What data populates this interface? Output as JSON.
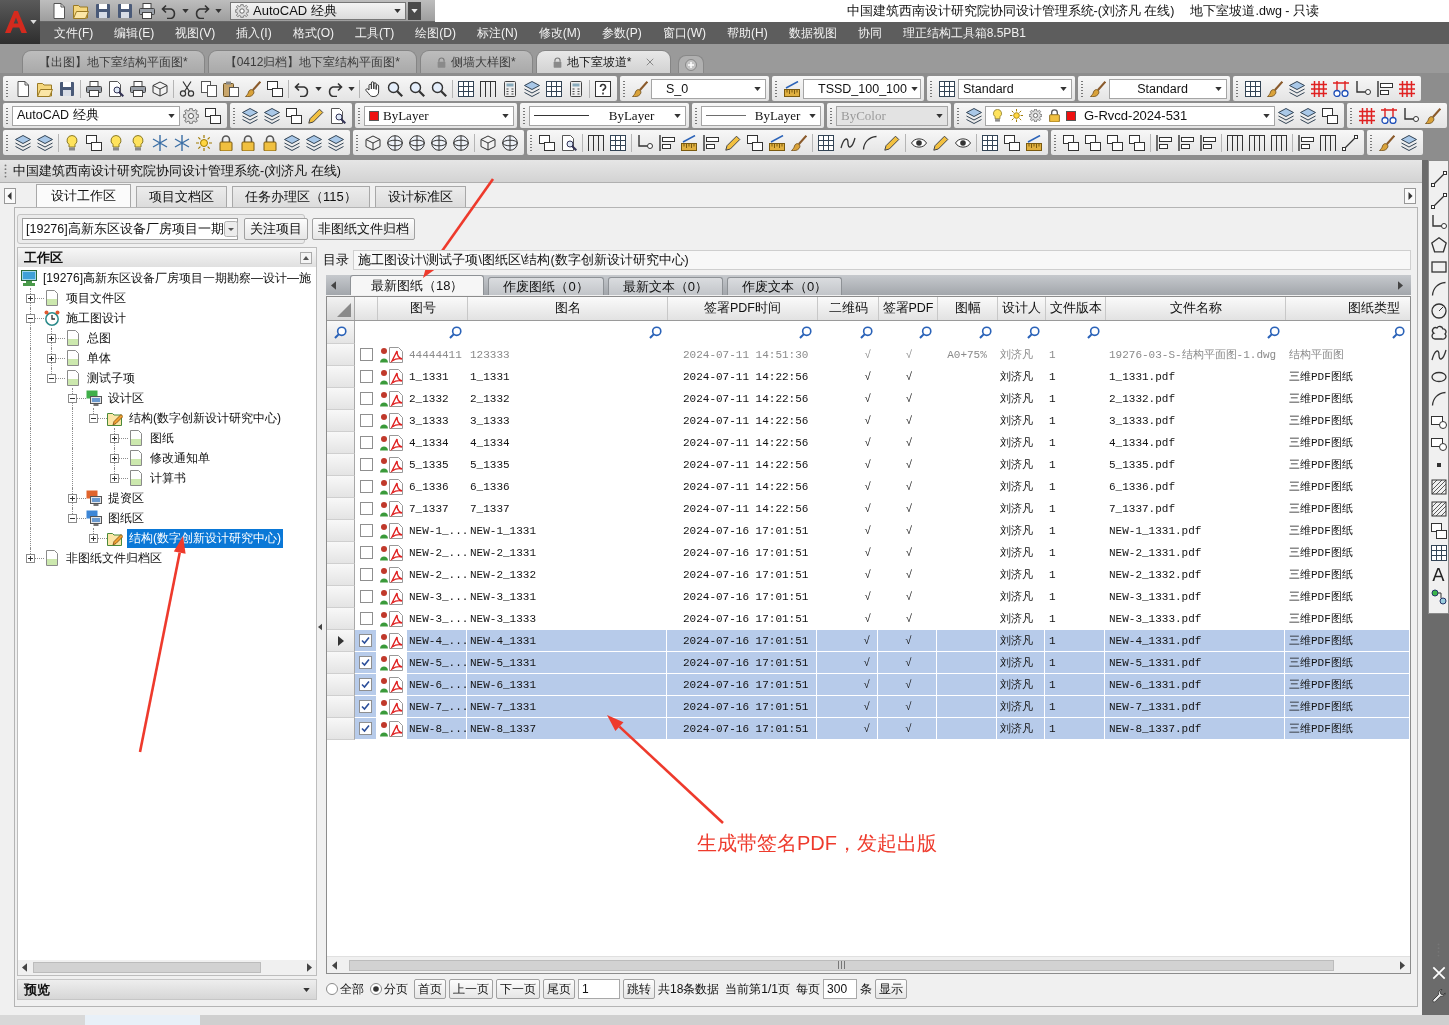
{
  "app": {
    "workspace": "AutoCAD 经典"
  },
  "title": {
    "app_title": "中国建筑西南设计研究院协同设计管理系统-(刘济凡 在线)",
    "document": "地下室坡道.dwg - 只读"
  },
  "menu": [
    "文件(F)",
    "编辑(E)",
    "视图(V)",
    "插入(I)",
    "格式(O)",
    "工具(T)",
    "绘图(D)",
    "标注(N)",
    "修改(M)",
    "参数(P)",
    "窗口(W)",
    "帮助(H)",
    "数据视图",
    "协同",
    "理正结构工具箱8.5PB1"
  ],
  "doc_tabs": [
    {
      "label": "【出图】地下室结构平面图*",
      "locked": false,
      "selected": false
    },
    {
      "label": "【0412归档】地下室结构平面图*",
      "locked": false,
      "selected": false
    },
    {
      "label": "侧墙大样图*",
      "locked": true,
      "selected": false
    },
    {
      "label": "地下室坡道*",
      "locked": true,
      "selected": true
    }
  ],
  "toolbars": {
    "text_style": "S_0",
    "dim_style": "TSSD_100_100",
    "table_style": "Standard",
    "multileader_style": "Standard",
    "workspace": "AutoCAD 经典",
    "color_mode": "ByLayer",
    "linetype": "ByLayer",
    "lineweight": "ByLayer",
    "plot_style": {
      "value": "ByColor",
      "disabled": true
    },
    "layer": "G-Rvcd-2024-531"
  },
  "panel": {
    "title": "中国建筑西南设计研究院协同设计管理系统-(刘济凡 在线)",
    "tabs": [
      {
        "label": "设计工作区",
        "selected": true
      },
      {
        "label": "项目文档区",
        "selected": false
      },
      {
        "label": "任务办理区（115）",
        "selected": false
      },
      {
        "label": "设计标准区",
        "selected": false
      }
    ]
  },
  "project_bar": {
    "project": "[19276]高新东区设备厂房项目一期",
    "follow_button": "关注项目",
    "archive_button": "非图纸文件归档"
  },
  "tree": {
    "title": "工作区",
    "root": {
      "label": "[19276]高新东区设备厂房项目一期勘察—设计—施",
      "kind": "computer",
      "selected": false,
      "children": [
        {
          "label": "项目文件区",
          "kind": "page",
          "expanded": false,
          "selected": false
        },
        {
          "label": "施工图设计",
          "kind": "clock",
          "expanded": true,
          "selected": false,
          "children": [
            {
              "label": "总图",
              "kind": "page",
              "expanded": false,
              "selected": false
            },
            {
              "label": "单体",
              "kind": "page",
              "expanded": false,
              "selected": false
            },
            {
              "label": "测试子项",
              "kind": "page",
              "expanded": true,
              "selected": false,
              "children": [
                {
                  "label": "设计区",
                  "kind": "monitor",
                  "color": "#3fae49",
                  "expanded": true,
                  "selected": false,
                  "children": [
                    {
                      "label": "结构(数字创新设计研究中心)",
                      "kind": "folder",
                      "expanded": true,
                      "selected": false,
                      "children": [
                        {
                          "label": "图纸",
                          "kind": "page",
                          "expanded": false,
                          "selected": false
                        },
                        {
                          "label": "修改通知单",
                          "kind": "page",
                          "expanded": false,
                          "selected": false
                        },
                        {
                          "label": "计算书",
                          "kind": "page",
                          "expanded": false,
                          "selected": false
                        }
                      ]
                    }
                  ]
                },
                {
                  "label": "提资区",
                  "kind": "monitor",
                  "color": "#e0642c",
                  "expanded": false,
                  "selected": false
                },
                {
                  "label": "图纸区",
                  "kind": "monitor",
                  "color": "#3d86d6",
                  "expanded": true,
                  "selected": false,
                  "children": [
                    {
                      "label": "结构(数字创新设计研究中心)",
                      "kind": "folder",
                      "expanded": false,
                      "selected": true
                    }
                  ]
                }
              ]
            }
          ]
        },
        {
          "label": "非图纸文件归档区",
          "kind": "page",
          "expanded": false,
          "selected": false
        }
      ]
    }
  },
  "preview": {
    "title": "预览"
  },
  "directory": {
    "label": "目录",
    "path": "施工图设计\\测试子项\\图纸区\\结构(数字创新设计研究中心)"
  },
  "file_tabs": [
    {
      "label": "最新图纸（18）",
      "selected": true
    },
    {
      "label": "作废图纸（0）",
      "selected": false
    },
    {
      "label": "最新文本（0）",
      "selected": false
    },
    {
      "label": "作废文本（0）",
      "selected": false
    }
  ],
  "table": {
    "columns": [
      "图号",
      "图名",
      "签署PDF时间",
      "二维码",
      "签署PDF",
      "图幅",
      "设计人",
      "文件版本",
      "文件名称",
      "图纸类型"
    ],
    "rows": [
      {
        "no": "44444411",
        "name": "123333",
        "signed_time": "2024-07-11 14:51:30",
        "qr": "√",
        "signed_pdf": "√",
        "size": "A0+75%",
        "designer": "刘济凡",
        "version": "1",
        "file_name": "19276-03-S-结构平面图-1.dwg",
        "type": "结构平面图",
        "checked": false,
        "selected": false,
        "current": false,
        "greyed": true
      },
      {
        "no": "1_1331",
        "name": "1_1331",
        "signed_time": "2024-07-11 14:22:56",
        "qr": "√",
        "signed_pdf": "√",
        "designer": "刘济凡",
        "version": "1",
        "file_name": "1_1331.pdf",
        "type": "三维PDF图纸",
        "checked": false,
        "selected": false,
        "current": false,
        "greyed": false
      },
      {
        "no": "2_1332",
        "name": "2_1332",
        "signed_time": "2024-07-11 14:22:56",
        "qr": "√",
        "signed_pdf": "√",
        "designer": "刘济凡",
        "version": "1",
        "file_name": "2_1332.pdf",
        "type": "三维PDF图纸",
        "checked": false,
        "selected": false,
        "current": false,
        "greyed": false
      },
      {
        "no": "3_1333",
        "name": "3_1333",
        "signed_time": "2024-07-11 14:22:56",
        "qr": "√",
        "signed_pdf": "√",
        "designer": "刘济凡",
        "version": "1",
        "file_name": "3_1333.pdf",
        "type": "三维PDF图纸",
        "checked": false,
        "selected": false,
        "current": false,
        "greyed": false
      },
      {
        "no": "4_1334",
        "name": "4_1334",
        "signed_time": "2024-07-11 14:22:56",
        "qr": "√",
        "signed_pdf": "√",
        "designer": "刘济凡",
        "version": "1",
        "file_name": "4_1334.pdf",
        "type": "三维PDF图纸",
        "checked": false,
        "selected": false,
        "current": false,
        "greyed": false
      },
      {
        "no": "5_1335",
        "name": "5_1335",
        "signed_time": "2024-07-11 14:22:56",
        "qr": "√",
        "signed_pdf": "√",
        "designer": "刘济凡",
        "version": "1",
        "file_name": "5_1335.pdf",
        "type": "三维PDF图纸",
        "checked": false,
        "selected": false,
        "current": false,
        "greyed": false
      },
      {
        "no": "6_1336",
        "name": "6_1336",
        "signed_time": "2024-07-11 14:22:56",
        "qr": "√",
        "signed_pdf": "√",
        "designer": "刘济凡",
        "version": "1",
        "file_name": "6_1336.pdf",
        "type": "三维PDF图纸",
        "checked": false,
        "selected": false,
        "current": false,
        "greyed": false
      },
      {
        "no": "7_1337",
        "name": "7_1337",
        "signed_time": "2024-07-11 14:22:56",
        "qr": "√",
        "signed_pdf": "√",
        "designer": "刘济凡",
        "version": "1",
        "file_name": "7_1337.pdf",
        "type": "三维PDF图纸",
        "checked": false,
        "selected": false,
        "current": false,
        "greyed": false
      },
      {
        "no": "NEW-1_...",
        "name": "NEW-1_1331",
        "signed_time": "2024-07-16 17:01:51",
        "qr": "√",
        "signed_pdf": "√",
        "designer": "刘济凡",
        "version": "1",
        "file_name": "NEW-1_1331.pdf",
        "type": "三维PDF图纸",
        "checked": false,
        "selected": false,
        "current": false,
        "greyed": false
      },
      {
        "no": "NEW-2_...",
        "name": "NEW-2_1331",
        "signed_time": "2024-07-16 17:01:51",
        "qr": "√",
        "signed_pdf": "√",
        "designer": "刘济凡",
        "version": "1",
        "file_name": "NEW-2_1331.pdf",
        "type": "三维PDF图纸",
        "checked": false,
        "selected": false,
        "current": false,
        "greyed": false
      },
      {
        "no": "NEW-2_...",
        "name": "NEW-2_1332",
        "signed_time": "2024-07-16 17:01:51",
        "qr": "√",
        "signed_pdf": "√",
        "designer": "刘济凡",
        "version": "1",
        "file_name": "NEW-2_1332.pdf",
        "type": "三维PDF图纸",
        "checked": false,
        "selected": false,
        "current": false,
        "greyed": false
      },
      {
        "no": "NEW-3_...",
        "name": "NEW-3_1331",
        "signed_time": "2024-07-16 17:01:51",
        "qr": "√",
        "signed_pdf": "√",
        "designer": "刘济凡",
        "version": "1",
        "file_name": "NEW-3_1331.pdf",
        "type": "三维PDF图纸",
        "checked": false,
        "selected": false,
        "current": false,
        "greyed": false
      },
      {
        "no": "NEW-3_...",
        "name": "NEW-3_1333",
        "signed_time": "2024-07-16 17:01:51",
        "qr": "√",
        "signed_pdf": "√",
        "designer": "刘济凡",
        "version": "1",
        "file_name": "NEW-3_1333.pdf",
        "type": "三维PDF图纸",
        "checked": false,
        "selected": false,
        "current": false,
        "greyed": false
      },
      {
        "no": "NEW-4_...",
        "name": "NEW-4_1331",
        "signed_time": "2024-07-16 17:01:51",
        "qr": "√",
        "signed_pdf": "√",
        "designer": "刘济凡",
        "version": "1",
        "file_name": "NEW-4_1331.pdf",
        "type": "三维PDF图纸",
        "checked": true,
        "selected": true,
        "current": true,
        "greyed": false
      },
      {
        "no": "NEW-5_...",
        "name": "NEW-5_1331",
        "signed_time": "2024-07-16 17:01:51",
        "qr": "√",
        "signed_pdf": "√",
        "designer": "刘济凡",
        "version": "1",
        "file_name": "NEW-5_1331.pdf",
        "type": "三维PDF图纸",
        "checked": true,
        "selected": true,
        "current": false,
        "greyed": false
      },
      {
        "no": "NEW-6_...",
        "name": "NEW-6_1331",
        "signed_time": "2024-07-16 17:01:51",
        "qr": "√",
        "signed_pdf": "√",
        "designer": "刘济凡",
        "version": "1",
        "file_name": "NEW-6_1331.pdf",
        "type": "三维PDF图纸",
        "checked": true,
        "selected": true,
        "current": false,
        "greyed": false
      },
      {
        "no": "NEW-7_...",
        "name": "NEW-7_1331",
        "signed_time": "2024-07-16 17:01:51",
        "qr": "√",
        "signed_pdf": "√",
        "designer": "刘济凡",
        "version": "1",
        "file_name": "NEW-7_1331.pdf",
        "type": "三维PDF图纸",
        "checked": true,
        "selected": true,
        "current": false,
        "greyed": false
      },
      {
        "no": "NEW-8_...",
        "name": "NEW-8_1337",
        "signed_time": "2024-07-16 17:01:51",
        "qr": "√",
        "signed_pdf": "√",
        "designer": "刘济凡",
        "version": "1",
        "file_name": "NEW-8_1337.pdf",
        "type": "三维PDF图纸",
        "checked": true,
        "selected": true,
        "current": false,
        "greyed": false
      }
    ]
  },
  "pager": {
    "modes": [
      {
        "label": "全部",
        "selected": false
      },
      {
        "label": "分页",
        "selected": true
      }
    ],
    "nav_buttons": [
      "首页",
      "上一页",
      "下一页",
      "尾页"
    ],
    "page": "1",
    "jump_button": "跳转",
    "total": "共18条数据",
    "current": "当前第1/1页",
    "per_page_label": "每页",
    "page_size": "300",
    "unit": "条",
    "show_button": "显示"
  },
  "side_toolbar": {
    "text_button": "A"
  },
  "annotation": {
    "text": "生成带签名PDF，发起出版"
  }
}
